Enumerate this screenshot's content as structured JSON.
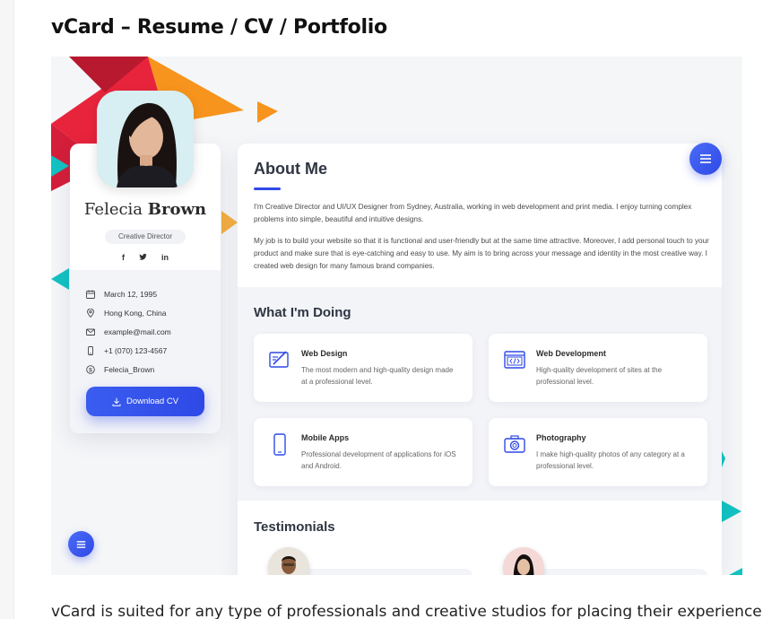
{
  "page": {
    "title": "vCard – Resume / CV / Portfolio",
    "body_text": "vCard is suited for any type of professionals and creative studios for placing their experience,"
  },
  "profile": {
    "first_name": "Felecia",
    "last_name": "Brown",
    "role": "Creative Director",
    "socials": [
      "f",
      "t",
      "in"
    ],
    "info": [
      {
        "icon": "calendar-icon",
        "text": "March 12, 1995"
      },
      {
        "icon": "location-icon",
        "text": "Hong Kong, China"
      },
      {
        "icon": "mail-icon",
        "text": "example@mail.com"
      },
      {
        "icon": "phone-icon",
        "text": "+1 (070) 123-4567"
      },
      {
        "icon": "skype-icon",
        "text": "Felecia_Brown"
      }
    ],
    "download_label": "Download CV"
  },
  "about": {
    "heading": "About Me",
    "p1": "I'm Creative Director and UI/UX Designer from Sydney, Australia, working in web development and print media. I enjoy turning complex problems into simple, beautiful and intuitive designs.",
    "p2": "My job is to build your website so that it is functional and user-friendly but at the same time attractive. Moreover, I add personal touch to your product and make sure that is eye-catching and easy to use. My aim is to bring across your message and identity in the most creative way. I created web design for many famous brand companies."
  },
  "doing": {
    "heading": "What I'm Doing",
    "items": [
      {
        "icon": "web-design-icon",
        "title": "Web Design",
        "desc": "The most modern and high-quality design made at a professional level."
      },
      {
        "icon": "web-development-icon",
        "title": "Web Development",
        "desc": "High-quality development of sites at the professional level."
      },
      {
        "icon": "mobile-apps-icon",
        "title": "Mobile Apps",
        "desc": "Professional development of applications for iOS and Android."
      },
      {
        "icon": "camera-icon",
        "title": "Photography",
        "desc": "I make high-quality photos of any category at a professional level."
      }
    ]
  },
  "testimonials": {
    "heading": "Testimonials"
  },
  "colors": {
    "accent": "#2f49e6",
    "teal": "#13c2c2",
    "orange": "#f7941d",
    "red": "#e8243c",
    "amber": "#f6b042"
  }
}
